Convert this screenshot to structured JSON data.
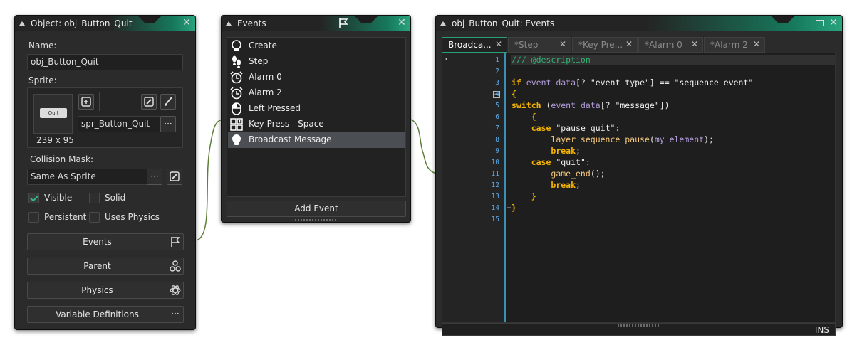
{
  "object_window": {
    "title": "Object: obj_Button_Quit",
    "name_label": "Name:",
    "name_value": "obj_Button_Quit",
    "sprite_label": "Sprite:",
    "sprite_thumb_text": "Quit",
    "sprite_size": "239 x 95",
    "sprite_name": "spr_Button_Quit",
    "collision_label": "Collision Mask:",
    "collision_value": "Same As Sprite",
    "checkboxes": [
      {
        "label": "Visible",
        "checked": true
      },
      {
        "label": "Solid",
        "checked": false
      },
      {
        "label": "Persistent",
        "checked": false
      },
      {
        "label": "Uses Physics",
        "checked": false
      }
    ],
    "buttons": [
      "Events",
      "Parent",
      "Physics",
      "Variable Definitions"
    ],
    "ellipsis": "···"
  },
  "events_window": {
    "title": "Events",
    "items": [
      {
        "label": "Create",
        "icon": "lightbulb-icon"
      },
      {
        "label": "Step",
        "icon": "footsteps-icon"
      },
      {
        "label": "Alarm 0",
        "icon": "alarm-clock-icon"
      },
      {
        "label": "Alarm 2",
        "icon": "alarm-clock-icon"
      },
      {
        "label": "Left Pressed",
        "icon": "mouse-icon"
      },
      {
        "label": "Key Press - Space",
        "icon": "keyboard-icon"
      },
      {
        "label": "Broadcast Message",
        "icon": "lightbulb-icon",
        "selected": true
      }
    ],
    "add_event": "Add Event"
  },
  "code_window": {
    "title": "obj_Button_Quit: Events",
    "tabs": [
      "Broadca...",
      "*Step",
      "*Key Pre...",
      "*Alarm 0",
      "*Alarm 2"
    ],
    "line_numbers": [
      "1",
      "2",
      "3",
      "4",
      "5",
      "6",
      "7",
      "8",
      "9",
      "10",
      "11",
      "12",
      "13",
      "14",
      "15"
    ],
    "status": "INS"
  },
  "colors": {
    "accent": "#28a47e",
    "panel": "#2b2b2b",
    "selection": "#4b4f54",
    "keyword": "#f4b400",
    "comment": "#35b174",
    "line_number": "#5aa7e6"
  }
}
